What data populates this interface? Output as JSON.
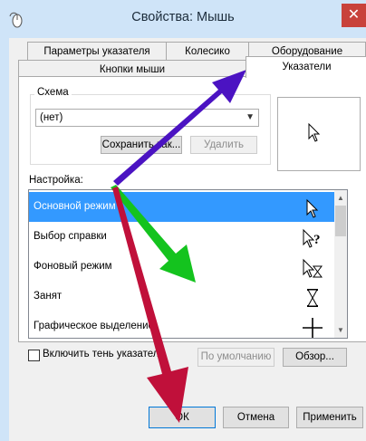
{
  "window": {
    "title": "Свойства: Мышь",
    "close_glyph": "✕"
  },
  "tabs": {
    "row1": [
      "Параметры указателя",
      "Колесико",
      "Оборудование"
    ],
    "row2": [
      "Кнопки мыши",
      "Указатели"
    ],
    "active": "Указатели"
  },
  "scheme": {
    "group_label": "Схема",
    "selected": "(нет)",
    "save_as_label": "Сохранить как...",
    "delete_label": "Удалить"
  },
  "customize": {
    "label": "Настройка:",
    "items": [
      {
        "name": "Основной режим",
        "cursor_icon": "arrow-cursor-icon",
        "selected": true
      },
      {
        "name": "Выбор справки",
        "cursor_icon": "help-cursor-icon",
        "selected": false
      },
      {
        "name": "Фоновый режим",
        "cursor_icon": "working-in-background-cursor-icon",
        "selected": false
      },
      {
        "name": "Занят",
        "cursor_icon": "busy-hourglass-cursor-icon",
        "selected": false
      },
      {
        "name": "Графическое выделение",
        "cursor_icon": "precision-crosshair-cursor-icon",
        "selected": false
      }
    ]
  },
  "shadow": {
    "label": "Включить тень указателя",
    "checked": false
  },
  "buttons": {
    "default_label": "По умолчанию",
    "browse_label": "Обзор...",
    "ok_label": "ОК",
    "cancel_label": "Отмена",
    "apply_label": "Применить"
  },
  "colors": {
    "selection": "#3399ff",
    "titlebar": "#cfe4f8",
    "close": "#c8423b",
    "arrow_purple": "#4b13c2",
    "arrow_green": "#14c31e",
    "arrow_red": "#c0103a"
  }
}
